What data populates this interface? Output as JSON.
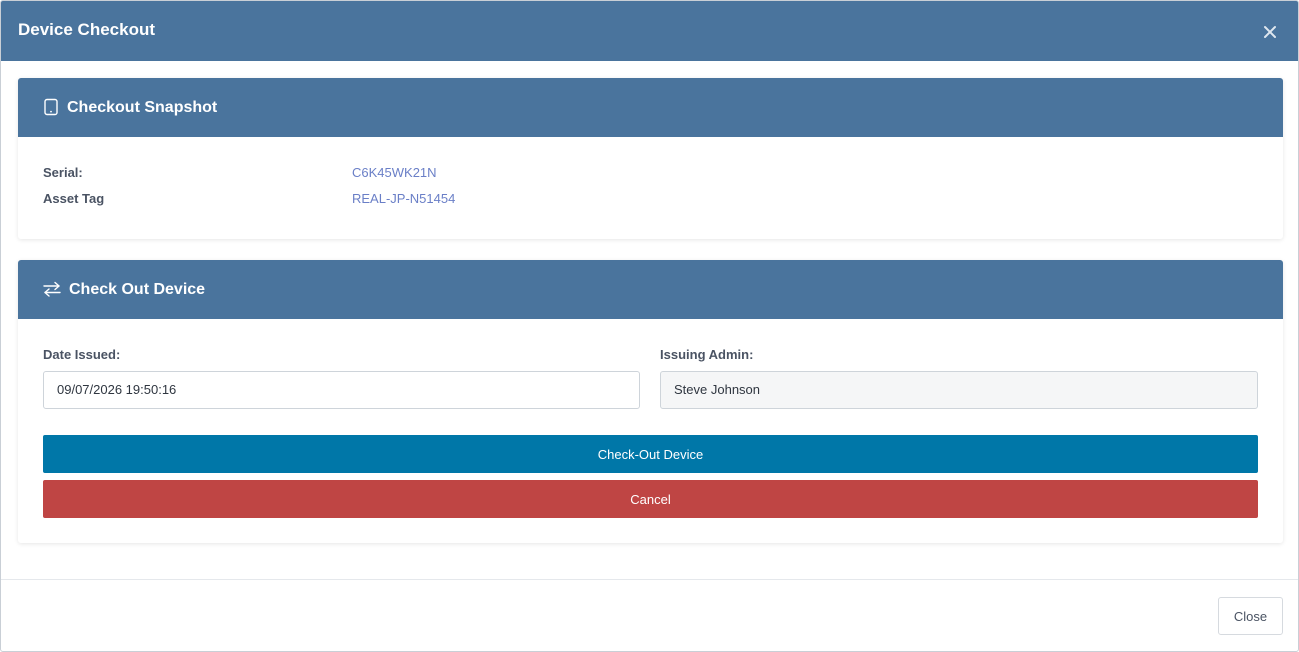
{
  "modal": {
    "title": "Device Checkout",
    "close_icon": "close-icon",
    "header_color": "#4a749d"
  },
  "snapshot": {
    "title": "Checkout Snapshot",
    "icon": "tablet-icon",
    "serial_label": "Serial:",
    "serial_value": "C6K45WK21N",
    "asset_tag_label": "Asset Tag",
    "asset_tag_value": "REAL-JP-N51454"
  },
  "checkout": {
    "title": "Check Out Device",
    "icon": "swap-arrows-icon",
    "date_issued_label": "Date Issued:",
    "date_issued_value": "09/07/2026 19:50:16",
    "issuing_admin_label": "Issuing Admin:",
    "issuing_admin_value": "Steve Johnson",
    "checkout_button": "Check-Out Device",
    "cancel_button": "Cancel",
    "primary_color": "#0077a8",
    "danger_color": "#bf4544"
  },
  "footer": {
    "close_button": "Close"
  }
}
